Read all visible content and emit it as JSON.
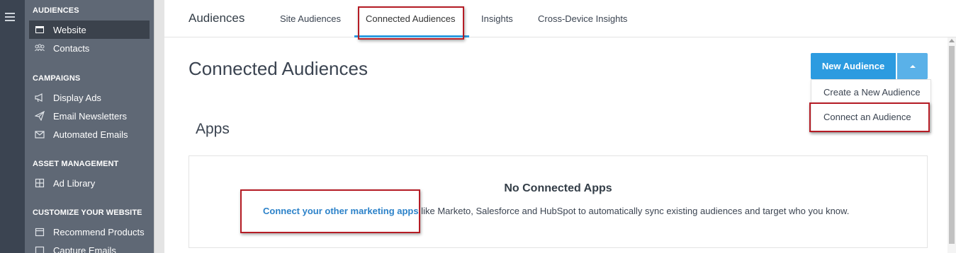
{
  "sidebar": {
    "sections": [
      {
        "title": "AUDIENCES",
        "items": [
          {
            "label": "Website",
            "icon": "browser-window-icon"
          },
          {
            "label": "Contacts",
            "icon": "contacts-icon"
          }
        ]
      },
      {
        "title": "CAMPAIGNS",
        "items": [
          {
            "label": "Display Ads",
            "icon": "megaphone-icon"
          },
          {
            "label": "Email Newsletters",
            "icon": "paper-plane-icon"
          },
          {
            "label": "Automated Emails",
            "icon": "envelope-icon"
          }
        ]
      },
      {
        "title": "ASSET MANAGEMENT",
        "items": [
          {
            "label": "Ad Library",
            "icon": "grid-icon"
          }
        ]
      },
      {
        "title": "CUSTOMIZE YOUR WEBSITE",
        "items": [
          {
            "label": "Recommend Products",
            "icon": "calendar-icon"
          },
          {
            "label": "Capture Emails",
            "icon": "capture-icon"
          }
        ]
      }
    ]
  },
  "topnav": {
    "brand": "Audiences",
    "tabs": [
      "Site Audiences",
      "Connected Audiences",
      "Insights",
      "Cross-Device Insights"
    ],
    "active_tab": "Connected Audiences"
  },
  "page": {
    "title": "Connected Audiences",
    "new_audience_button": "New Audience",
    "dropdown": [
      "Create a New Audience",
      "Connect an Audience"
    ],
    "section_title": "Apps",
    "panel_title": "No Connected Apps",
    "panel_link": "Connect your other marketing apps",
    "panel_text": " like Marketo, Salesforce and HubSpot to automatically sync existing audiences and target who you know."
  },
  "colors": {
    "accent": "#2c9be0",
    "sidebar": "#5f6875",
    "rail": "#3b4451",
    "highlight": "#b51c25"
  }
}
